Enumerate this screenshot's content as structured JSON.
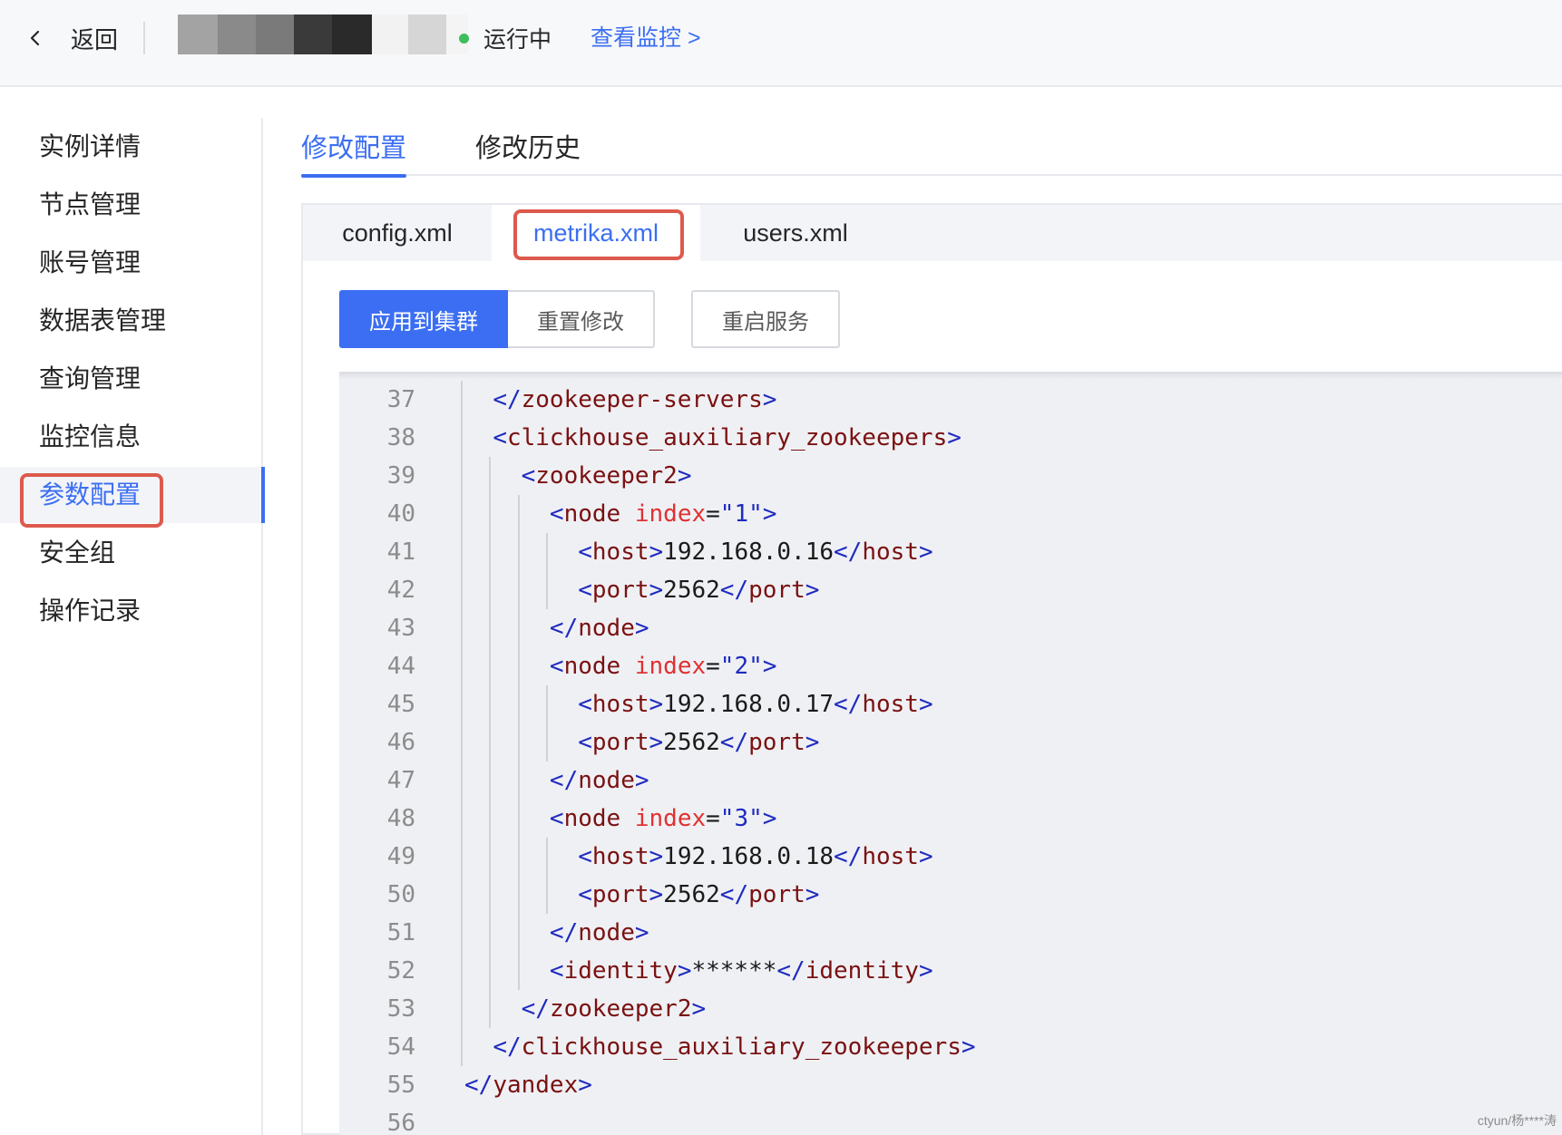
{
  "header": {
    "back_label": "返回",
    "status_text": "运行中",
    "status_color": "#3dbe5c",
    "monitor_link": "查看监控 >"
  },
  "sidebar": {
    "items": [
      {
        "label": "实例详情"
      },
      {
        "label": "节点管理"
      },
      {
        "label": "账号管理"
      },
      {
        "label": "数据表管理"
      },
      {
        "label": "查询管理"
      },
      {
        "label": "监控信息"
      },
      {
        "label": "参数配置",
        "active": true
      },
      {
        "label": "安全组"
      },
      {
        "label": "操作记录"
      }
    ]
  },
  "top_tabs": [
    {
      "label": "修改配置",
      "active": true
    },
    {
      "label": "修改历史"
    }
  ],
  "file_tabs": [
    {
      "label": "config.xml"
    },
    {
      "label": "metrika.xml",
      "active": true
    },
    {
      "label": "users.xml"
    }
  ],
  "buttons": {
    "apply": "应用到集群",
    "reset": "重置修改",
    "restart": "重启服务"
  },
  "editor": {
    "lines": [
      {
        "n": "37",
        "text": "  </zookeeper-servers>"
      },
      {
        "n": "38",
        "text": "  <clickhouse_auxiliary_zookeepers>"
      },
      {
        "n": "39",
        "text": "    <zookeeper2>"
      },
      {
        "n": "40",
        "text": "      <node index=\"1\">"
      },
      {
        "n": "41",
        "text": "        <host>192.168.0.16</host>"
      },
      {
        "n": "42",
        "text": "        <port>2562</port>"
      },
      {
        "n": "43",
        "text": "      </node>"
      },
      {
        "n": "44",
        "text": "      <node index=\"2\">"
      },
      {
        "n": "45",
        "text": "        <host>192.168.0.17</host>"
      },
      {
        "n": "46",
        "text": "        <port>2562</port>"
      },
      {
        "n": "47",
        "text": "      </node>"
      },
      {
        "n": "48",
        "text": "      <node index=\"3\">"
      },
      {
        "n": "49",
        "text": "        <host>192.168.0.18</host>"
      },
      {
        "n": "50",
        "text": "        <port>2562</port>"
      },
      {
        "n": "51",
        "text": "      </node>"
      },
      {
        "n": "52",
        "text": "      <identity>******</identity>"
      },
      {
        "n": "53",
        "text": "    </zookeeper2>"
      },
      {
        "n": "54",
        "text": "  </clickhouse_auxiliary_zookeepers>"
      },
      {
        "n": "55",
        "text": "</yandex>"
      },
      {
        "n": "56",
        "text": ""
      }
    ]
  },
  "watermark": "ctyun/杨****涛",
  "colors": {
    "accent": "#3b6ef2",
    "highlight_box": "#dc5a4d"
  }
}
